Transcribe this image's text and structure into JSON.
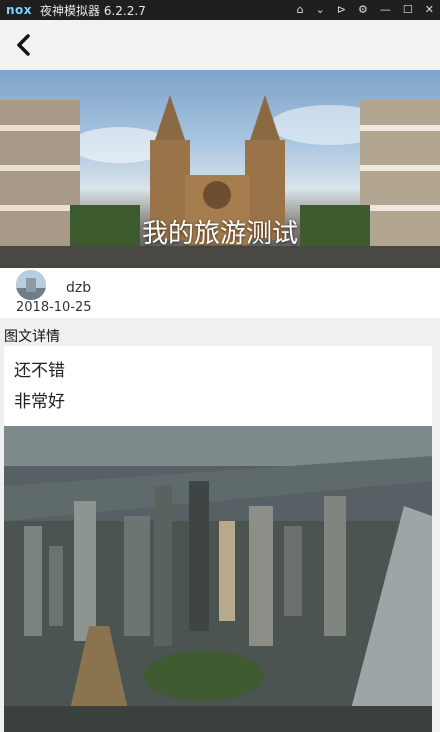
{
  "emulator": {
    "logo": "nox",
    "title": "夜神模拟器 6.2.2.7"
  },
  "app_bar": {
    "back_icon": "chevron-left-icon"
  },
  "hero": {
    "title": "我的旅游测试"
  },
  "author": {
    "name": "dzb",
    "date": "2018-10-25"
  },
  "section": {
    "label": "图文详情"
  },
  "content": {
    "lines": [
      "还不错",
      "非常好"
    ]
  },
  "colors": {
    "emulator_bar": "#1f1f1f",
    "app_bar_bg": "#f2f2f2",
    "page_bg": "#f0f0f0",
    "card_bg": "#ffffff"
  }
}
